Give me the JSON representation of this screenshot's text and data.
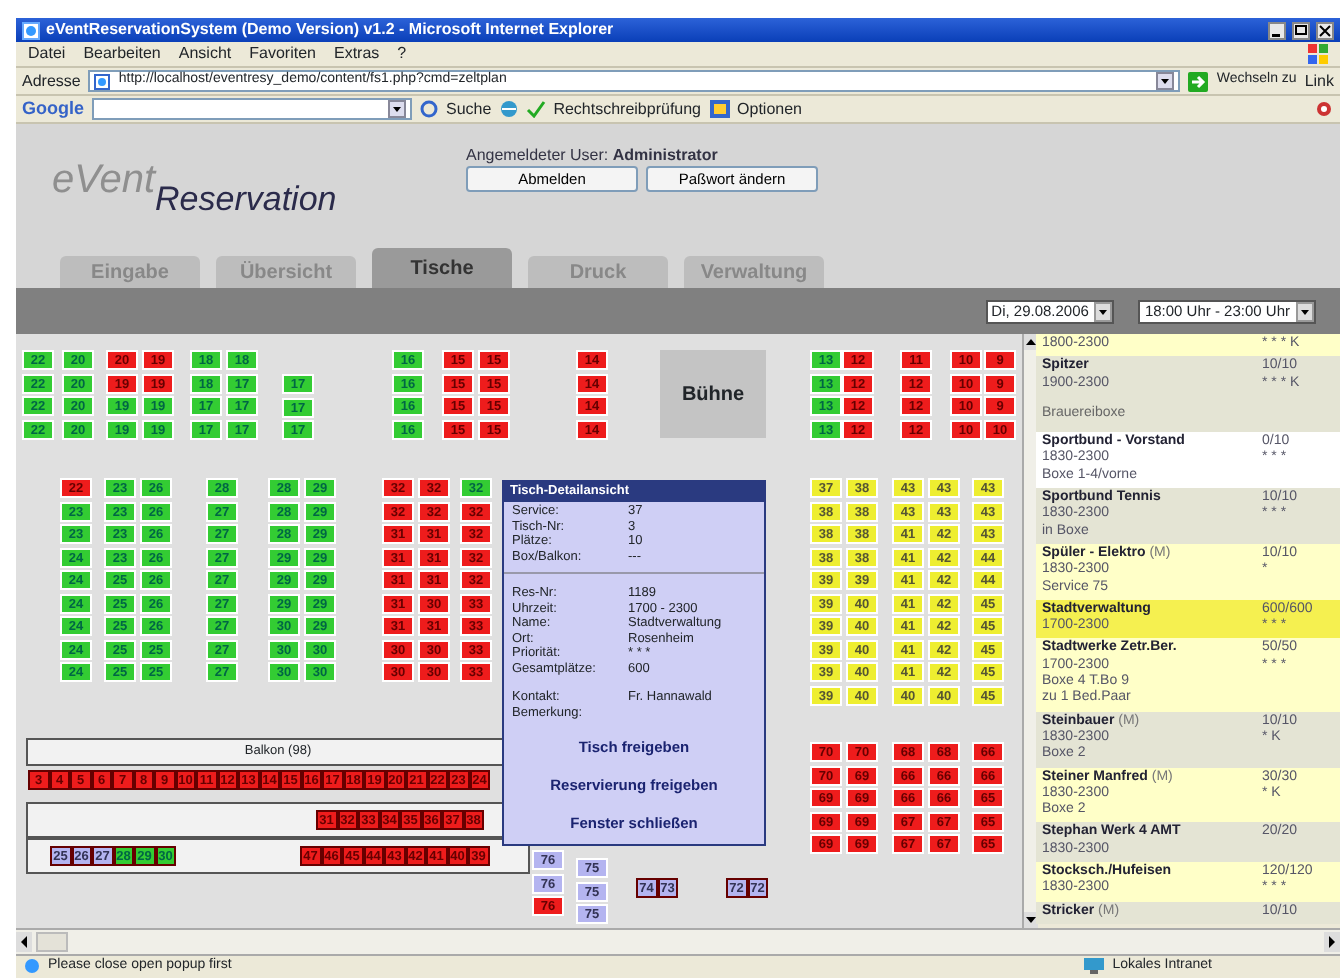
{
  "window": {
    "title": "eVentReservationSystem (Demo Version) v1.2 - Microsoft Internet Explorer"
  },
  "menu": [
    "Datei",
    "Bearbeiten",
    "Ansicht",
    "Favoriten",
    "Extras",
    "?"
  ],
  "address_bar": {
    "label": "Adresse",
    "url": "http://localhost/eventresy_demo/content/fs1.php?cmd=zeltplan",
    "go": "Wechseln zu",
    "links": "Link"
  },
  "google_bar": {
    "logo": "Google",
    "search": "Suche",
    "spellcheck": "Rechtschreibprüfung",
    "options": "Optionen"
  },
  "header": {
    "logo_top": "eVent",
    "logo_bottom": "Reservation",
    "user": "Angemeldeter User: **Administrator**",
    "buttons": [
      "Abmelden",
      "Paßwort ändern"
    ]
  },
  "tabs": [
    {
      "label": "Eingabe",
      "selected": false
    },
    {
      "label": "Übersicht",
      "selected": false
    },
    {
      "label": "Tische",
      "selected": true
    },
    {
      "label": "Druck",
      "selected": false
    },
    {
      "label": "Verwaltung",
      "selected": false
    }
  ],
  "filters": {
    "date": "Di, 29.08.2006",
    "time": "18:00 Uhr - 23:00 Uhr"
  },
  "floor": {
    "stage": "Bühne",
    "balcony": "Balkon (98)",
    "blocks": [
      {
        "kind": "column",
        "columns": [
          [
            {
              "kind": "free",
              "seats": [
                "22",
                "22",
                "22",
                "22"
              ]
            }
          ]
        ]
      },
      {
        "kind": "column",
        "columns": [
          [
            {
              "kind": "free",
              "seats": [
                "20",
                "20",
                "20",
                "20"
              ]
            }
          ]
        ]
      },
      {
        "kind": "column",
        "columns": [
          [
            {
              "kind": "booked",
              "seats": [
                "20",
                "19"
              ]
            },
            {
              "kind": "free",
              "seats": [
                "19",
                "19"
              ]
            }
          ],
          [
            {
              "kind": "booked",
              "seats": [
                "19",
                "19"
              ]
            },
            {
              "kind": "free",
              "seats": [
                "19",
                "19"
              ]
            }
          ]
        ]
      },
      {
        "kind": "column",
        "columns": [
          [
            {
              "kind": "free",
              "seats": [
                "18",
                "18",
                "17",
                "17"
              ]
            }
          ],
          [
            {
              "kind": "free",
              "seats": [
                "18",
                "17",
                "17",
                "17"
              ]
            }
          ]
        ]
      },
      {
        "kind": "column",
        "columns": [
          [
            {
              "kind": "free",
              "seats": [
                "17",
                "17",
                "17"
              ]
            }
          ]
        ]
      },
      {
        "kind": "column",
        "columns": [
          [
            {
              "kind": "free",
              "seats": [
                "16",
                "16",
                "16",
                "16"
              ]
            }
          ]
        ]
      },
      {
        "kind": "column",
        "columns": [
          [
            {
              "kind": "booked",
              "seats": [
                "15",
                "15",
                "15",
                "15"
              ]
            }
          ],
          [
            {
              "kind": "booked",
              "seats": [
                "15",
                "15",
                "15",
                "15"
              ]
            }
          ]
        ]
      },
      {
        "kind": "column",
        "columns": [
          [
            {
              "kind": "booked",
              "seats": [
                "14",
                "14",
                "14",
                "14"
              ]
            }
          ]
        ]
      },
      {
        "kind": "column",
        "columns": [
          [
            {
              "kind": "free",
              "seats": [
                "13",
                "13",
                "13",
                "13"
              ]
            }
          ]
        ]
      },
      {
        "kind": "column",
        "columns": [
          [
            {
              "kind": "booked",
              "seats": [
                "12",
                "12",
                "12",
                "12"
              ]
            }
          ]
        ]
      },
      {
        "kind": "column",
        "columns": [
          [
            {
              "kind": "booked",
              "seats": [
                "11",
                "12",
                "12",
                "12"
              ]
            }
          ]
        ]
      },
      {
        "kind": "column",
        "columns": [
          [
            {
              "kind": "booked",
              "seats": [
                "10",
                "10",
                "10",
                "10"
              ]
            }
          ]
        ]
      },
      {
        "kind": "column",
        "columns": [
          [
            {
              "kind": "booked",
              "seats": [
                "9",
                "9",
                "9",
                "10"
              ]
            }
          ]
        ]
      },
      {
        "kind": "column",
        "columns": [
          [
            {
              "kind": "booked",
              "seats": [
                "22"
              ]
            },
            {
              "kind": "free",
              "seats": [
                "23",
                "23",
                "24",
                "24",
                "24",
                "24",
                "24",
                "24"
              ]
            }
          ]
        ]
      },
      {
        "kind": "column",
        "columns": [
          [
            {
              "kind": "free",
              "seats": [
                "23",
                "23",
                "23",
                "23",
                "25",
                "25",
                "25",
                "25",
                "25"
              ]
            }
          ],
          [
            {
              "kind": "free",
              "seats": [
                "26",
                "26",
                "26",
                "26",
                "26",
                "26",
                "26",
                "25",
                "25"
              ]
            }
          ]
        ]
      },
      {
        "kind": "column",
        "columns": [
          [
            {
              "kind": "free",
              "seats": [
                "28",
                "27",
                "27",
                "27",
                "27",
                "27",
                "27",
                "27",
                "27"
              ]
            }
          ]
        ]
      },
      {
        "kind": "column",
        "columns": [
          [
            {
              "kind": "free",
              "seats": [
                "28",
                "28",
                "28",
                "29",
                "29",
                "29",
                "30",
                "30",
                "30"
              ]
            }
          ],
          [
            {
              "kind": "free",
              "seats": [
                "29",
                "29",
                "29",
                "29",
                "29",
                "29",
                "29",
                "30",
                "30"
              ]
            }
          ]
        ]
      },
      {
        "kind": "column",
        "columns": [
          [
            {
              "kind": "booked",
              "seats": [
                "32",
                "32",
                "31",
                "31",
                "31",
                "31",
                "31",
                "30",
                "30"
              ]
            }
          ],
          [
            {
              "kind": "booked",
              "seats": [
                "32",
                "32",
                "31",
                "31",
                "31",
                "30",
                "31",
                "30",
                "30"
              ]
            }
          ]
        ]
      },
      {
        "kind": "column",
        "columns": [
          [
            {
              "kind": "free",
              "seats": [
                "32"
              ]
            },
            {
              "kind": "booked",
              "seats": [
                "32",
                "32",
                "32",
                "32",
                "33",
                "33",
                "33",
                "33"
              ]
            }
          ]
        ]
      },
      {
        "kind": "column",
        "columns": [
          [
            {
              "kind": "held",
              "seats": [
                "37",
                "38",
                "38",
                "38",
                "39",
                "39",
                "39",
                "39",
                "39",
                "39"
              ]
            }
          ],
          [
            {
              "kind": "held",
              "seats": [
                "38",
                "38",
                "38",
                "38",
                "39",
                "40",
                "40",
                "40",
                "40",
                "40"
              ]
            }
          ]
        ]
      },
      {
        "kind": "column",
        "columns": [
          [
            {
              "kind": "held",
              "seats": [
                "43",
                "43",
                "41",
                "41",
                "41",
                "41",
                "41",
                "41",
                "41",
                "40"
              ]
            }
          ],
          [
            {
              "kind": "held",
              "seats": [
                "43",
                "43",
                "42",
                "42",
                "42",
                "42",
                "42",
                "42",
                "42",
                "40"
              ]
            }
          ]
        ]
      },
      {
        "kind": "column",
        "columns": [
          [
            {
              "kind": "held",
              "seats": [
                "43",
                "43",
                "43",
                "44",
                "44",
                "45",
                "45",
                "45",
                "45",
                "45"
              ]
            }
          ]
        ]
      },
      {
        "kind": "row",
        "columns": [
          [
            {
              "kind": "booked",
              "seats": [
                "3",
                "4",
                "5",
                "6",
                "7",
                "8",
                "9",
                "10",
                "11",
                "12",
                "13",
                "14",
                "15",
                "16",
                "17",
                "18",
                "19",
                "20",
                "21",
                "22",
                "23",
                "24"
              ]
            }
          ]
        ]
      },
      {
        "kind": "row",
        "columns": [
          [
            {
              "kind": "booked",
              "seats": [
                "31",
                "32",
                "33",
                "34",
                "35",
                "36",
                "37",
                "38"
              ]
            }
          ]
        ]
      },
      {
        "kind": "row",
        "columns": [
          [
            {
              "kind": "blocked",
              "seats": [
                "25",
                "26",
                "27"
              ]
            },
            {
              "kind": "free",
              "seats": [
                "28",
                "29",
                "30"
              ]
            }
          ]
        ]
      },
      {
        "kind": "row",
        "columns": [
          [
            {
              "kind": "booked",
              "seats": [
                "47",
                "46",
                "45",
                "44",
                "43",
                "42",
                "41",
                "40",
                "39"
              ]
            }
          ]
        ]
      },
      {
        "kind": "column",
        "columns": [
          [
            {
              "kind": "blocked",
              "seats": [
                "76",
                "76"
              ]
            },
            {
              "kind": "booked",
              "seats": [
                "76"
              ]
            }
          ]
        ]
      },
      {
        "kind": "column",
        "columns": [
          [
            {
              "kind": "blocked",
              "seats": [
                "75",
                "75",
                "75"
              ]
            }
          ]
        ]
      },
      {
        "kind": "row",
        "columns": [
          [
            {
              "kind": "blocked",
              "seats": [
                "74",
                "73"
              ]
            }
          ]
        ]
      },
      {
        "kind": "row",
        "columns": [
          [
            {
              "kind": "blocked",
              "seats": [
                "72",
                "72"
              ]
            }
          ]
        ]
      },
      {
        "kind": "column",
        "columns": [
          [
            {
              "kind": "booked",
              "seats": [
                "70",
                "70",
                "69",
                "69",
                "69"
              ]
            }
          ],
          [
            {
              "kind": "booked",
              "seats": [
                "70",
                "69",
                "69",
                "69",
                "69"
              ]
            }
          ]
        ]
      },
      {
        "kind": "column",
        "columns": [
          [
            {
              "kind": "booked",
              "seats": [
                "68",
                "66",
                "66",
                "67",
                "67"
              ]
            }
          ],
          [
            {
              "kind": "booked",
              "seats": [
                "68",
                "66",
                "66",
                "67",
                "67"
              ]
            }
          ]
        ]
      },
      {
        "kind": "column",
        "columns": [
          [
            {
              "kind": "booked",
              "seats": [
                "66",
                "66",
                "65",
                "65",
                "65"
              ]
            }
          ]
        ]
      }
    ]
  },
  "popup": {
    "title": "Tisch-Detailansicht",
    "fields": [
      {
        "label": "Service:",
        "value": "37"
      },
      {
        "label": "Tisch-Nr:",
        "value": "3"
      },
      {
        "label": "Plätze:",
        "value": "10"
      },
      {
        "label": "Box/Balkon:",
        "value": "---"
      }
    ],
    "reservation": [
      {
        "label": "Res-Nr:",
        "value": "1189"
      },
      {
        "label": "Uhrzeit:",
        "value": "1700 - 2300"
      },
      {
        "label": "Name:",
        "value": "Stadtverwaltung"
      },
      {
        "label": "Ort:",
        "value": "Rosenheim"
      },
      {
        "label": "Priorität:",
        "value": "* * *"
      },
      {
        "label": "Gesamtplätze:",
        "value": "600"
      }
    ],
    "contact": [
      {
        "label": "Kontakt:",
        "value": "Fr. Hannawald"
      },
      {
        "label": "Bemerkung:"
      }
    ],
    "actions": [
      "Tisch freigeben",
      "Reservierung freigeben",
      "Fenster schließen"
    ]
  },
  "reservations": [
    {
      "kind": "entry",
      "color": "#ffffc8",
      "lines": [
        "1800-2300"
      ],
      "rating": "* * * K"
    },
    {
      "kind": "entry",
      "color": "#e4e4d4",
      "name": "Spitzer",
      "lines": [
        "1900-2300"
      ],
      "count": "10/10",
      "rating": "* * * K"
    },
    {
      "kind": "group",
      "color": "#e4e4d4",
      "name": "Brauereiboxe"
    },
    {
      "kind": "entry",
      "color": "#ffffff",
      "name": "Sportbund - Vorstand",
      "lines": [
        "1830-2300",
        "Boxe 1-4/vorne"
      ],
      "count": "0/10",
      "rating": "* * *"
    },
    {
      "kind": "entry",
      "color": "#e4e4d4",
      "name": "Sportbund Tennis",
      "lines": [
        "1830-2300",
        "in Boxe"
      ],
      "count": "10/10",
      "rating": "* * *"
    },
    {
      "kind": "entry",
      "color": "#ffffc8",
      "name": "Spüler - Elektro",
      "suffix": "(M)",
      "lines": [
        "1830-2300",
        "Service 75"
      ],
      "count": "10/10",
      "rating": "*"
    },
    {
      "kind": "entry",
      "color": "#f5f050",
      "name": "Stadtverwaltung",
      "lines": [
        "1700-2300"
      ],
      "count": "600/600",
      "rating": "* * *"
    },
    {
      "kind": "entry",
      "color": "#ffffc8",
      "name": "Stadtwerke Zetr.Ber.",
      "lines": [
        "1700-2300",
        "Boxe 4 T.Bo 9",
        "zu 1 Bed.Paar"
      ],
      "count": "50/50",
      "rating": "* * *"
    },
    {
      "kind": "entry",
      "color": "#e4e4d4",
      "name": "Steinbauer",
      "suffix": "(M)",
      "lines": [
        "1830-2300",
        "Boxe 2"
      ],
      "count": "10/10",
      "rating": "* K"
    },
    {
      "kind": "entry",
      "color": "#ffffc8",
      "name": "Steiner Manfred",
      "suffix": "(M)",
      "lines": [
        "1830-2300",
        "Boxe 2"
      ],
      "count": "30/30",
      "rating": "* K"
    },
    {
      "kind": "entry",
      "color": "#e4e4d4",
      "name": "Stephan Werk 4 AMT",
      "lines": [
        "1830-2300"
      ],
      "count": "20/20"
    },
    {
      "kind": "entry",
      "color": "#ffffc8",
      "name": "Stocksch./Hufeisen",
      "lines": [
        "1830-2300"
      ],
      "count": "120/120",
      "rating": "* * *"
    },
    {
      "kind": "entry",
      "color": "#e4e4d4",
      "name": "Stricker",
      "suffix": "(M)",
      "count": "10/10"
    }
  ],
  "status_bar": {
    "message": "Please close open popup first",
    "zone": "Lokales Intranet"
  }
}
